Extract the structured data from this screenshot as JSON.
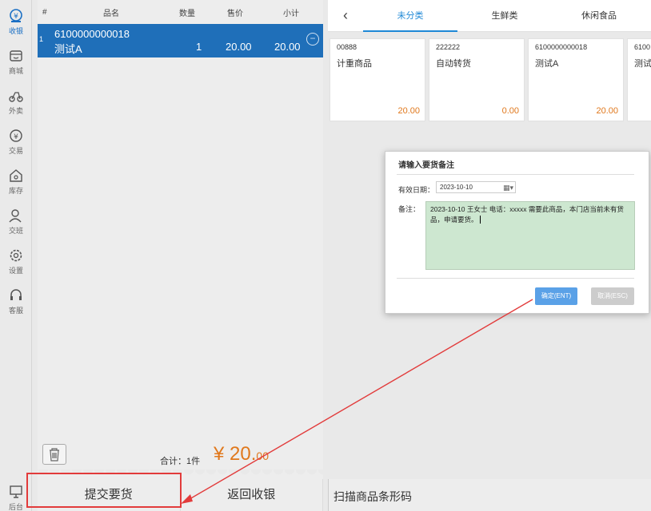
{
  "sidebar": {
    "items": [
      {
        "label": "收银",
        "icon": "cashier-icon"
      },
      {
        "label": "商城",
        "icon": "store-icon"
      },
      {
        "label": "外卖",
        "icon": "delivery-icon"
      },
      {
        "label": "交易",
        "icon": "transaction-icon"
      },
      {
        "label": "库存",
        "icon": "inventory-icon"
      },
      {
        "label": "交班",
        "icon": "shift-icon"
      },
      {
        "label": "设置",
        "icon": "settings-icon"
      },
      {
        "label": "客服",
        "icon": "support-icon"
      },
      {
        "label": "后台",
        "icon": "backend-icon"
      }
    ]
  },
  "cart": {
    "headers": {
      "num": "#",
      "name": "品名",
      "qty": "数量",
      "price": "售价",
      "subtotal": "小计"
    },
    "rows": [
      {
        "index": "1",
        "code": "6100000000018",
        "name": "测试A",
        "qty": "1",
        "price": "20.00",
        "subtotal": "20.00"
      }
    ],
    "total_label": "合计：1件",
    "total_symbol": "¥",
    "total_int": "20.",
    "total_dec": "00"
  },
  "bottom": {
    "submit_label": "提交要货",
    "return_label": "返回收银"
  },
  "categories": {
    "items": [
      "未分类",
      "生鲜类",
      "休闲食品"
    ],
    "active_index": 0
  },
  "products": [
    {
      "code": "00888",
      "name": "计重商品",
      "price": "20.00"
    },
    {
      "code": "222222",
      "name": "自动转货",
      "price": "0.00"
    },
    {
      "code": "6100000000018",
      "name": "测试A",
      "price": "20.00"
    },
    {
      "code": "6100",
      "name": "测试",
      "price": ""
    }
  ],
  "scan": {
    "placeholder": "扫描商品条形码"
  },
  "dialog": {
    "title": "请输入要货备注",
    "date_label": "有效日期：",
    "date_value": "2023-10-10",
    "note_label": "备注：",
    "note_text": "2023-10-10 王女士 电话：xxxxx  需要此商品，本门店当前未有货品，申请要货。",
    "ok_label": "确定(ENT)",
    "cancel_label": "取消(ESC)"
  },
  "colors": {
    "accent": "#1f6fb9",
    "price": "#e0781c",
    "note_bg": "#cde7d0",
    "annotation": "#e23b3b"
  }
}
